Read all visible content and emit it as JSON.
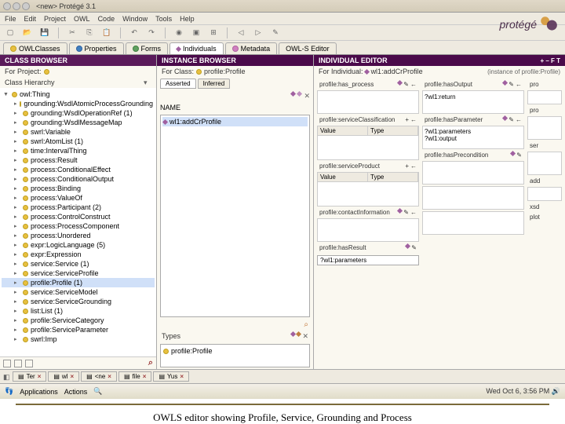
{
  "window": {
    "title": "<new>  Protégé 3.1"
  },
  "menu": {
    "file": "File",
    "edit": "Edit",
    "project": "Project",
    "owl": "OWL",
    "code": "Code",
    "window": "Window",
    "tools": "Tools",
    "help": "Help"
  },
  "logo": "protégé",
  "tabs": {
    "owlclasses": "OWLClasses",
    "properties": "Properties",
    "forms": "Forms",
    "individuals": "Individuals",
    "metadata": "Metadata",
    "owlseditor": "OWL-S Editor"
  },
  "classBrowser": {
    "title": "CLASS BROWSER",
    "forProject": "For Project:",
    "hierarchyLabel": "Class Hierarchy",
    "root": "owl:Thing",
    "items": [
      {
        "label": "grounding:WsdlAtomicProcessGrounding"
      },
      {
        "label": "grounding:WsdlOperationRef  (1)"
      },
      {
        "label": "grounding:WsdlMessageMap"
      },
      {
        "label": "swrl:Variable"
      },
      {
        "label": "swrl:AtomList  (1)"
      },
      {
        "label": "time:IntervalThing"
      },
      {
        "label": "process:Result"
      },
      {
        "label": "process:ConditionalEffect"
      },
      {
        "label": "process:ConditionalOutput"
      },
      {
        "label": "process:Binding"
      },
      {
        "label": "process:ValueOf"
      },
      {
        "label": "process:Participant  (2)"
      },
      {
        "label": "process:ControlConstruct"
      },
      {
        "label": "process:ProcessComponent"
      },
      {
        "label": "process:Unordered"
      },
      {
        "label": "expr:LogicLanguage  (5)"
      },
      {
        "label": "expr:Expression"
      },
      {
        "label": "service:Service  (1)"
      },
      {
        "label": "service:ServiceProfile"
      },
      {
        "label": "profile:Profile  (1)",
        "selected": true
      },
      {
        "label": "service:ServiceModel"
      },
      {
        "label": "service:ServiceGrounding"
      },
      {
        "label": "list:List  (1)"
      },
      {
        "label": "profile:ServiceCategory"
      },
      {
        "label": "profile:ServiceParameter"
      },
      {
        "label": "swrl:Imp"
      }
    ]
  },
  "instanceBrowser": {
    "title": "INSTANCE BROWSER",
    "forClass": "For Class:",
    "className": "profile:Profile",
    "tabs": {
      "asserted": "Asserted",
      "inferred": "Inferred"
    },
    "nameLabel": "NAME",
    "searchValue": "wl1:addCrProfile",
    "typesLabel": "Types",
    "typeValue": "profile:Profile"
  },
  "individualEditor": {
    "title": "INDIVIDUAL EDITOR",
    "forIndividual": "For Individual:",
    "individualName": "wl1:addCrProfile",
    "instanceNote": "(instance of profile:Profile)",
    "fields": {
      "hasProcess": "profile:has_process",
      "serviceClass": "profile:serviceClassification",
      "hasParameter": "profile:hasParameter",
      "serviceProduct": "profile:serviceProduct",
      "contactInfo": "profile:contactInformation",
      "hasResult": "profile:hasResult",
      "hasOutput": "profile:hasOutput",
      "hasPrecondition": "profile:hasPrecondition",
      "pro": "pro",
      "proShort": "pro",
      "ser": "ser",
      "addShort": "add",
      "xsdShort": "xsd",
      "plotShort": "plot"
    },
    "returnValue": "?wl1:return",
    "paramsValue": "?wl1:parameters",
    "outputValue": "?wl1:output",
    "inlineParams": "?wl1:parameters",
    "tableHeaders": {
      "value": "Value",
      "type": "Type"
    }
  },
  "bottomTabs": {
    "tab1": "Ter",
    "tab2": "wl",
    "tab3": "<ne",
    "tab4": "file",
    "tab5": "Yus"
  },
  "taskbar": {
    "apps": "Applications",
    "actions": "Actions",
    "clock": "Wed Oct 6,  3:56 PM"
  },
  "caption": "OWLS editor showing Profile, Service, Grounding and Process"
}
